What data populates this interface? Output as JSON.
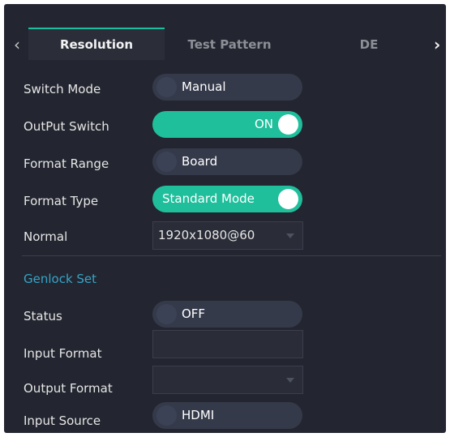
{
  "tabs": [
    {
      "label": "Resolution",
      "active": true
    },
    {
      "label": "Test Pattern",
      "active": false
    },
    {
      "label": "DE",
      "active": false
    }
  ],
  "nav": {
    "prev_glyph": "‹",
    "next_glyph": "›"
  },
  "settings": {
    "switch_mode": {
      "label": "Switch Mode",
      "value": "Manual",
      "state": "off"
    },
    "output_switch": {
      "label": "OutPut Switch",
      "value": "ON",
      "state": "on"
    },
    "format_range": {
      "label": "Format Range",
      "value": "Board",
      "state": "off"
    },
    "format_type": {
      "label": "Format Type",
      "value": "Standard Mode",
      "state": "on"
    },
    "normal": {
      "label": "Normal",
      "value": "1920x1080@60"
    }
  },
  "genlock": {
    "title": "Genlock Set",
    "status": {
      "label": "Status",
      "value": "OFF",
      "state": "off"
    },
    "input_format": {
      "label": "Input Format",
      "value": ""
    },
    "output_format": {
      "label": "Output Format",
      "value": ""
    },
    "input_source": {
      "label": "Input Source",
      "value": "HDMI",
      "state": "off"
    }
  },
  "colors": {
    "accent": "#1fbf9c",
    "section": "#35a3c7",
    "panel": "#232630"
  }
}
